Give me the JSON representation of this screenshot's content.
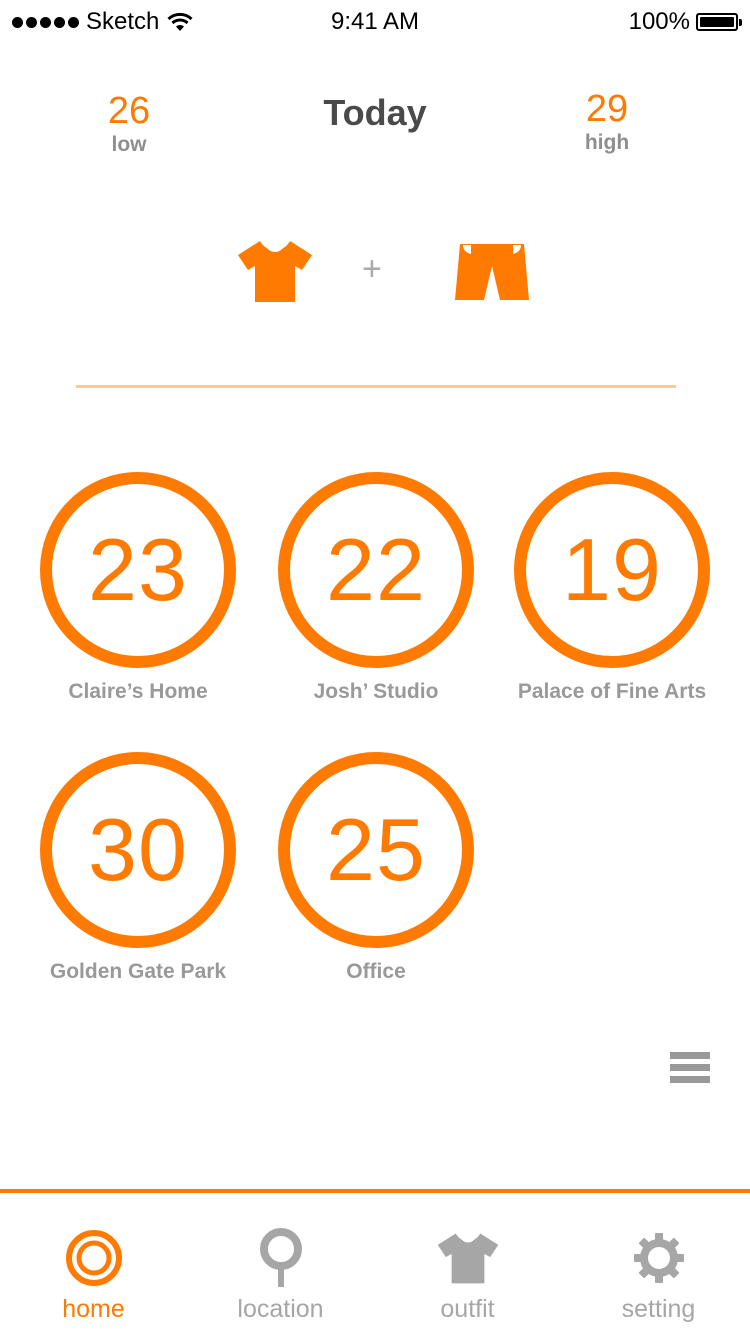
{
  "status_bar": {
    "carrier": "Sketch",
    "time": "9:41 AM",
    "battery": "100%"
  },
  "header": {
    "low_value": "26",
    "low_label": "low",
    "title": "Today",
    "high_value": "29",
    "high_label": "high"
  },
  "outfit": {
    "top_icon": "tshirt-icon",
    "bottom_icon": "shorts-icon",
    "plus": "+"
  },
  "locations": [
    {
      "temp": "23",
      "name": "Claire’s Home"
    },
    {
      "temp": "22",
      "name": "Josh’ Studio"
    },
    {
      "temp": "19",
      "name": "Palace of Fine Arts"
    },
    {
      "temp": "30",
      "name": "Golden Gate Park"
    },
    {
      "temp": "25",
      "name": "Office"
    }
  ],
  "tabs": [
    {
      "label": "home",
      "icon": "target-icon",
      "active": true
    },
    {
      "label": "location",
      "icon": "pin-icon",
      "active": false
    },
    {
      "label": "outfit",
      "icon": "tshirt-icon",
      "active": false
    },
    {
      "label": "setting",
      "icon": "gear-icon",
      "active": false
    }
  ],
  "colors": {
    "accent": "#ff7a00",
    "divider": "#ffc98c",
    "muted": "#999999",
    "tab_inactive": "#a6a6a6"
  }
}
